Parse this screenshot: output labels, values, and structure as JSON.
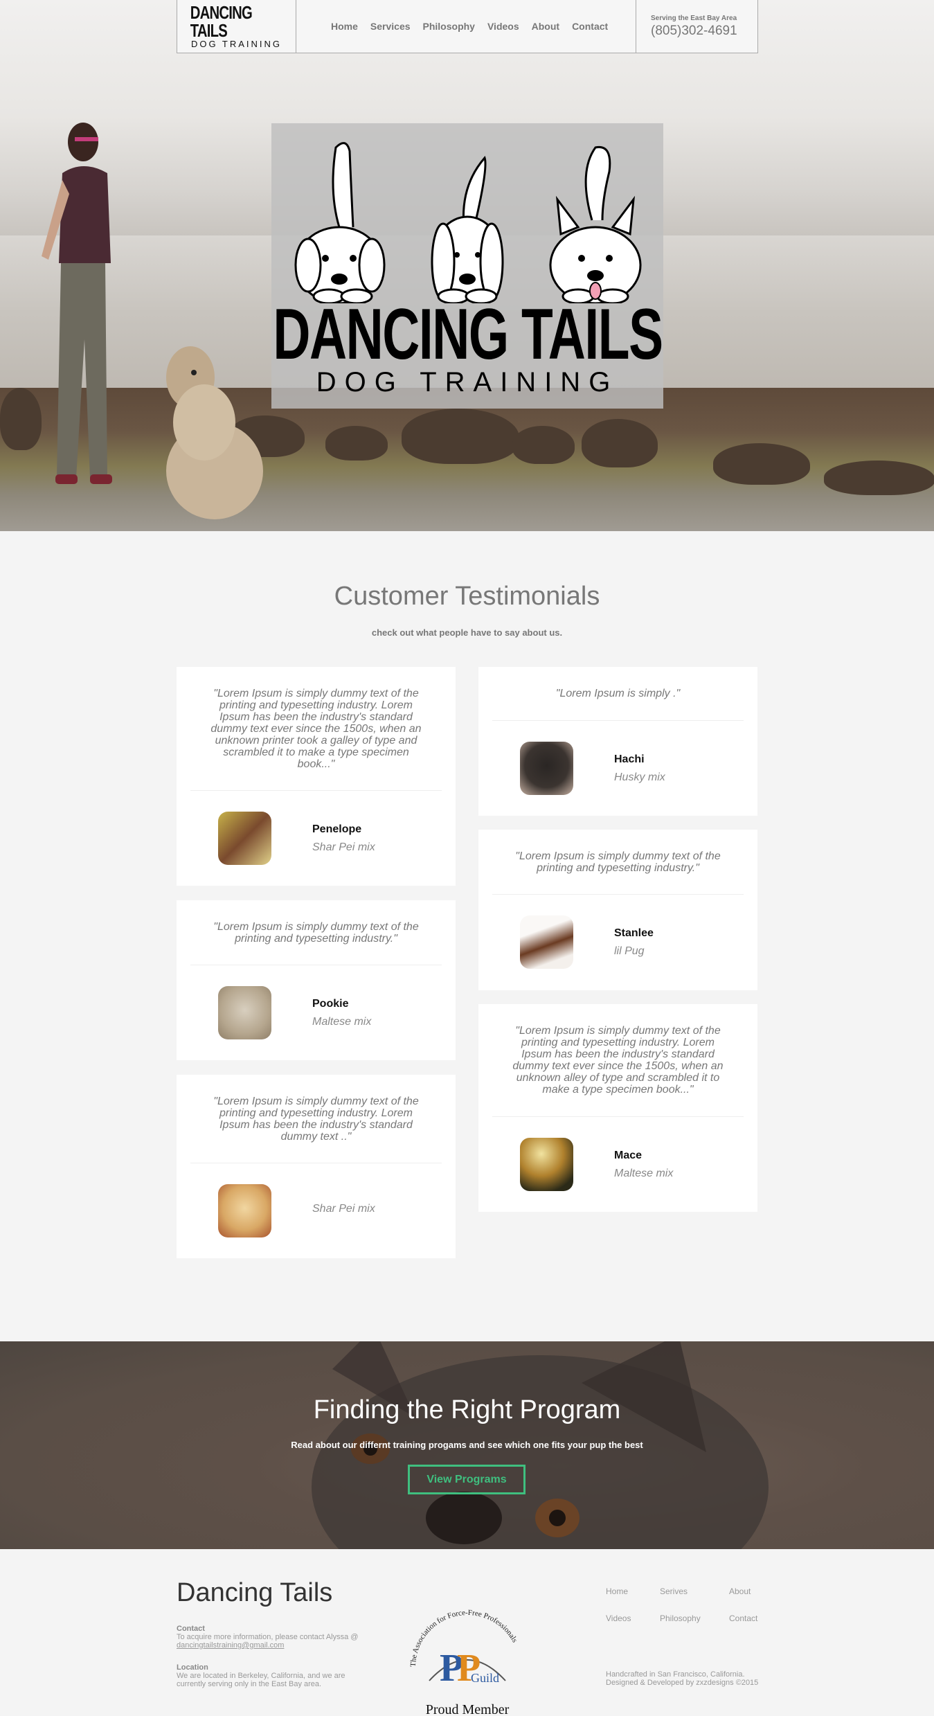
{
  "header": {
    "logo_top": "DANCING TAILS",
    "logo_bottom": "DOG TRAINING",
    "nav": [
      "Home",
      "Services",
      "Philosophy",
      "Videos",
      "About",
      "Contact"
    ],
    "serving": "Serving the East Bay Area",
    "phone": "(805)302-4691"
  },
  "hero": {
    "title": "DANCING TAILS",
    "subtitle": "DOG TRAINING"
  },
  "testimonials": {
    "title": "Customer Testimonials",
    "subtitle": "check out what people have to say about us.",
    "items": [
      {
        "quote": "\"Lorem Ipsum is simply dummy text of the printing and typesetting industry. Lorem Ipsum has been the industry's standard dummy text ever since the 1500s, when an unknown printer took a galley of type and scrambled it to make a type specimen book...\"",
        "name": "Penelope",
        "breed": "Shar Pei mix"
      },
      {
        "quote": "\"Lorem Ipsum is simply dummy text of the printing and typesetting industry.\"",
        "name": "Pookie",
        "breed": "Maltese mix"
      },
      {
        "quote": "\"Lorem Ipsum is simply dummy text of the printing and typesetting industry. Lorem Ipsum has been the industry's standard dummy text ..\"",
        "name": "",
        "breed": "Shar Pei mix"
      },
      {
        "quote": "\"Lorem Ipsum is simply .\"",
        "name": "Hachi",
        "breed": "Husky mix"
      },
      {
        "quote": "\"Lorem Ipsum is simply dummy text of the printing and typesetting industry.\"",
        "name": "Stanlee",
        "breed": "lil Pug"
      },
      {
        "quote": "\"Lorem Ipsum is simply dummy text of the printing and typesetting industry. Lorem Ipsum has been the industry's standard dummy text ever since the 1500s, when an unknown alley of type and scrambled it to make a type specimen book...\"",
        "name": "Mace",
        "breed": "Maltese mix"
      }
    ]
  },
  "program": {
    "title": "Finding the Right Program",
    "subtitle": "Read about our differnt training progams and see which one fits your pup the best",
    "button": "View Programs"
  },
  "footer": {
    "brand": "Dancing Tails",
    "contact_label": "Contact",
    "contact_text": "To acquire more information, please contact Alyssa @",
    "contact_email": "dancingtailstraining@gmail.com",
    "location_label": "Location",
    "location_text": "We are located in Berkeley, California, and we are currently serving only in the East Bay area.",
    "badge_arc": "The Association for Force-Free Professionals",
    "badge_guild": "Guild",
    "badge_member": "Proud Member",
    "nav": [
      "Home",
      "Serives",
      "About",
      "Videos",
      "Philosophy",
      "Contact"
    ],
    "credit_1": "Handcrafted in San Francisco, California.",
    "credit_2": "Designed & Developed by zxzdesigns ©2015"
  }
}
